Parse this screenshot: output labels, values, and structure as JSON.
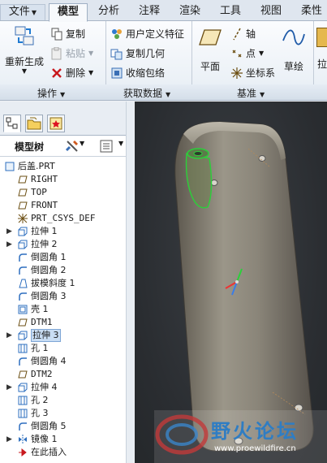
{
  "tabs": [
    {
      "label": "文件",
      "has_dropdown": true
    },
    {
      "label": "模型",
      "active": true
    },
    {
      "label": "分析"
    },
    {
      "label": "注释"
    },
    {
      "label": "渲染"
    },
    {
      "label": "工具"
    },
    {
      "label": "视图"
    },
    {
      "label": "柔性"
    }
  ],
  "ribbon": {
    "operations": {
      "regenerate": "重新生成",
      "copy": "复制",
      "paste": "粘贴",
      "delete": "删除",
      "group_label": "操作"
    },
    "get_data": {
      "udf": "用户定义特征",
      "copy_geometry": "复制几何",
      "shrinkwrap": "收缩包络",
      "group_label": "获取数据"
    },
    "datum": {
      "plane": "平面",
      "axis": "轴",
      "point": "点",
      "csys": "坐标系",
      "sketch": "草绘",
      "group_label": "基准",
      "extra": "拉"
    }
  },
  "panel": {
    "title": "模型树"
  },
  "tree": [
    {
      "label": "后盖.PRT",
      "icon": "part-icon",
      "expand": false,
      "indent": 0
    },
    {
      "label": "RIGHT",
      "icon": "datum-plane-icon",
      "indent": 1
    },
    {
      "label": "TOP",
      "icon": "datum-plane-icon",
      "indent": 1
    },
    {
      "label": "FRONT",
      "icon": "datum-plane-icon",
      "indent": 1
    },
    {
      "label": "PRT_CSYS_DEF",
      "icon": "csys-icon",
      "indent": 1
    },
    {
      "label": "拉伸 1",
      "icon": "extrude-icon",
      "expand": true,
      "indent": 1
    },
    {
      "label": "拉伸 2",
      "icon": "extrude-icon",
      "expand": true,
      "indent": 1
    },
    {
      "label": "倒圆角 1",
      "icon": "round-icon",
      "indent": 1
    },
    {
      "label": "倒圆角 2",
      "icon": "round-icon",
      "indent": 1
    },
    {
      "label": "拔模斜度 1",
      "icon": "draft-icon",
      "indent": 1
    },
    {
      "label": "倒圆角 3",
      "icon": "round-icon",
      "indent": 1
    },
    {
      "label": "壳 1",
      "icon": "shell-icon",
      "indent": 1
    },
    {
      "label": "DTM1",
      "icon": "datum-plane-icon",
      "indent": 1
    },
    {
      "label": "拉伸 3",
      "icon": "extrude-icon",
      "expand": true,
      "indent": 1,
      "selected": true
    },
    {
      "label": "孔 1",
      "icon": "hole-icon",
      "indent": 1
    },
    {
      "label": "倒圆角 4",
      "icon": "round-icon",
      "indent": 1
    },
    {
      "label": "DTM2",
      "icon": "datum-plane-icon",
      "indent": 1
    },
    {
      "label": "拉伸 4",
      "icon": "extrude-icon",
      "expand": true,
      "indent": 1
    },
    {
      "label": "孔 2",
      "icon": "hole-icon",
      "indent": 1
    },
    {
      "label": "孔 3",
      "icon": "hole-icon",
      "indent": 1
    },
    {
      "label": "倒圆角 5",
      "icon": "round-icon",
      "indent": 1
    },
    {
      "label": "镜像 1",
      "icon": "mirror-icon",
      "expand": true,
      "indent": 1
    },
    {
      "label": "在此插入",
      "icon": "insert-here-icon",
      "indent": 1
    }
  ],
  "watermark": {
    "title": "野火论坛",
    "url": "www.proewildfire.cn"
  }
}
